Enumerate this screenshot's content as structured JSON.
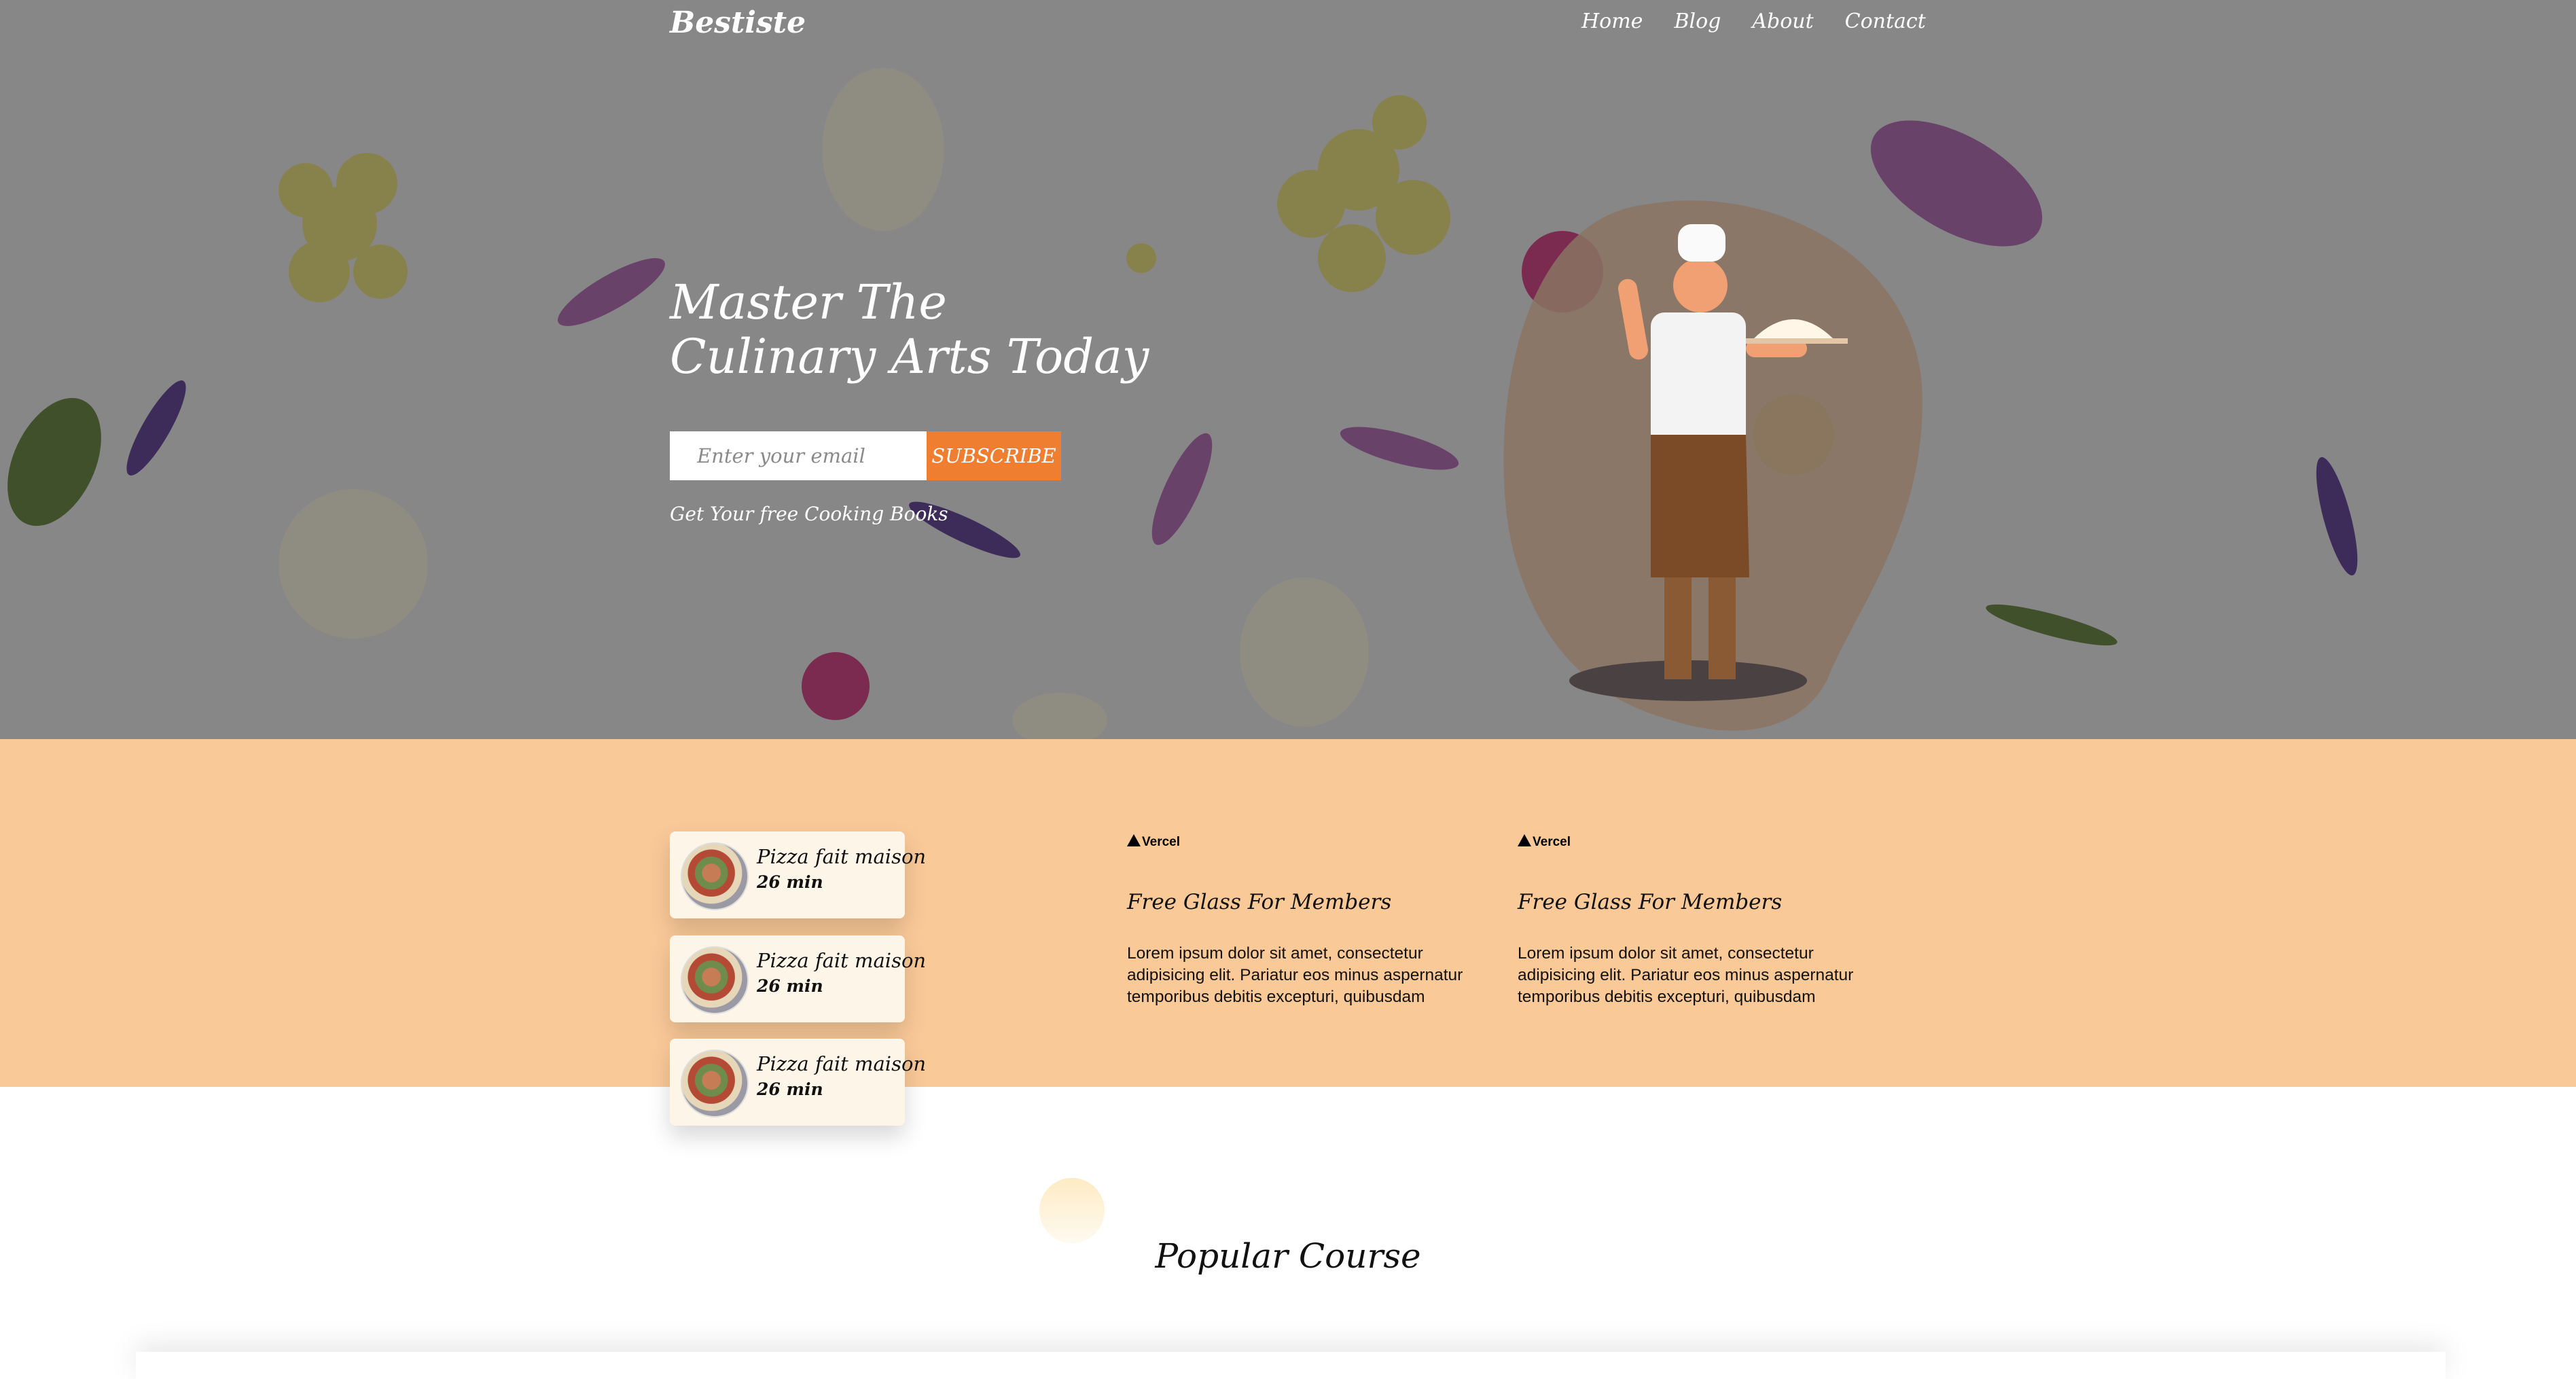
{
  "brand": "Bestiste",
  "nav": [
    "Home",
    "Blog",
    "About",
    "Contact"
  ],
  "hero": {
    "title_line1": "Master The",
    "title_line2": "Culinary Arts Today",
    "email_placeholder": "Enter your email",
    "subscribe_label": "SUBSCRIBE",
    "subtext": "Get Your free Cooking Books"
  },
  "recipes": [
    {
      "name": "Pizza fait maison",
      "time": "26 min"
    },
    {
      "name": "Pizza fait maison",
      "time": "26 min"
    },
    {
      "name": "Pizza fait maison",
      "time": "26 min"
    }
  ],
  "features": [
    {
      "logo": "Vercel",
      "title": "Free Glass For Members",
      "body": "Lorem ipsum dolor sit amet, consectetur adipisicing elit. Pariatur eos minus aspernatur temporibus debitis excepturi, quibusdam"
    },
    {
      "logo": "Vercel",
      "title": "Free Glass For Members",
      "body": "Lorem ipsum dolor sit amet, consectetur adipisicing elit. Pariatur eos minus aspernatur temporibus debitis excepturi, quibusdam"
    }
  ],
  "popular_title": "Popular Course",
  "colors": {
    "accent": "#ef7e30",
    "band": "#fac998",
    "card": "#fef5e9"
  }
}
